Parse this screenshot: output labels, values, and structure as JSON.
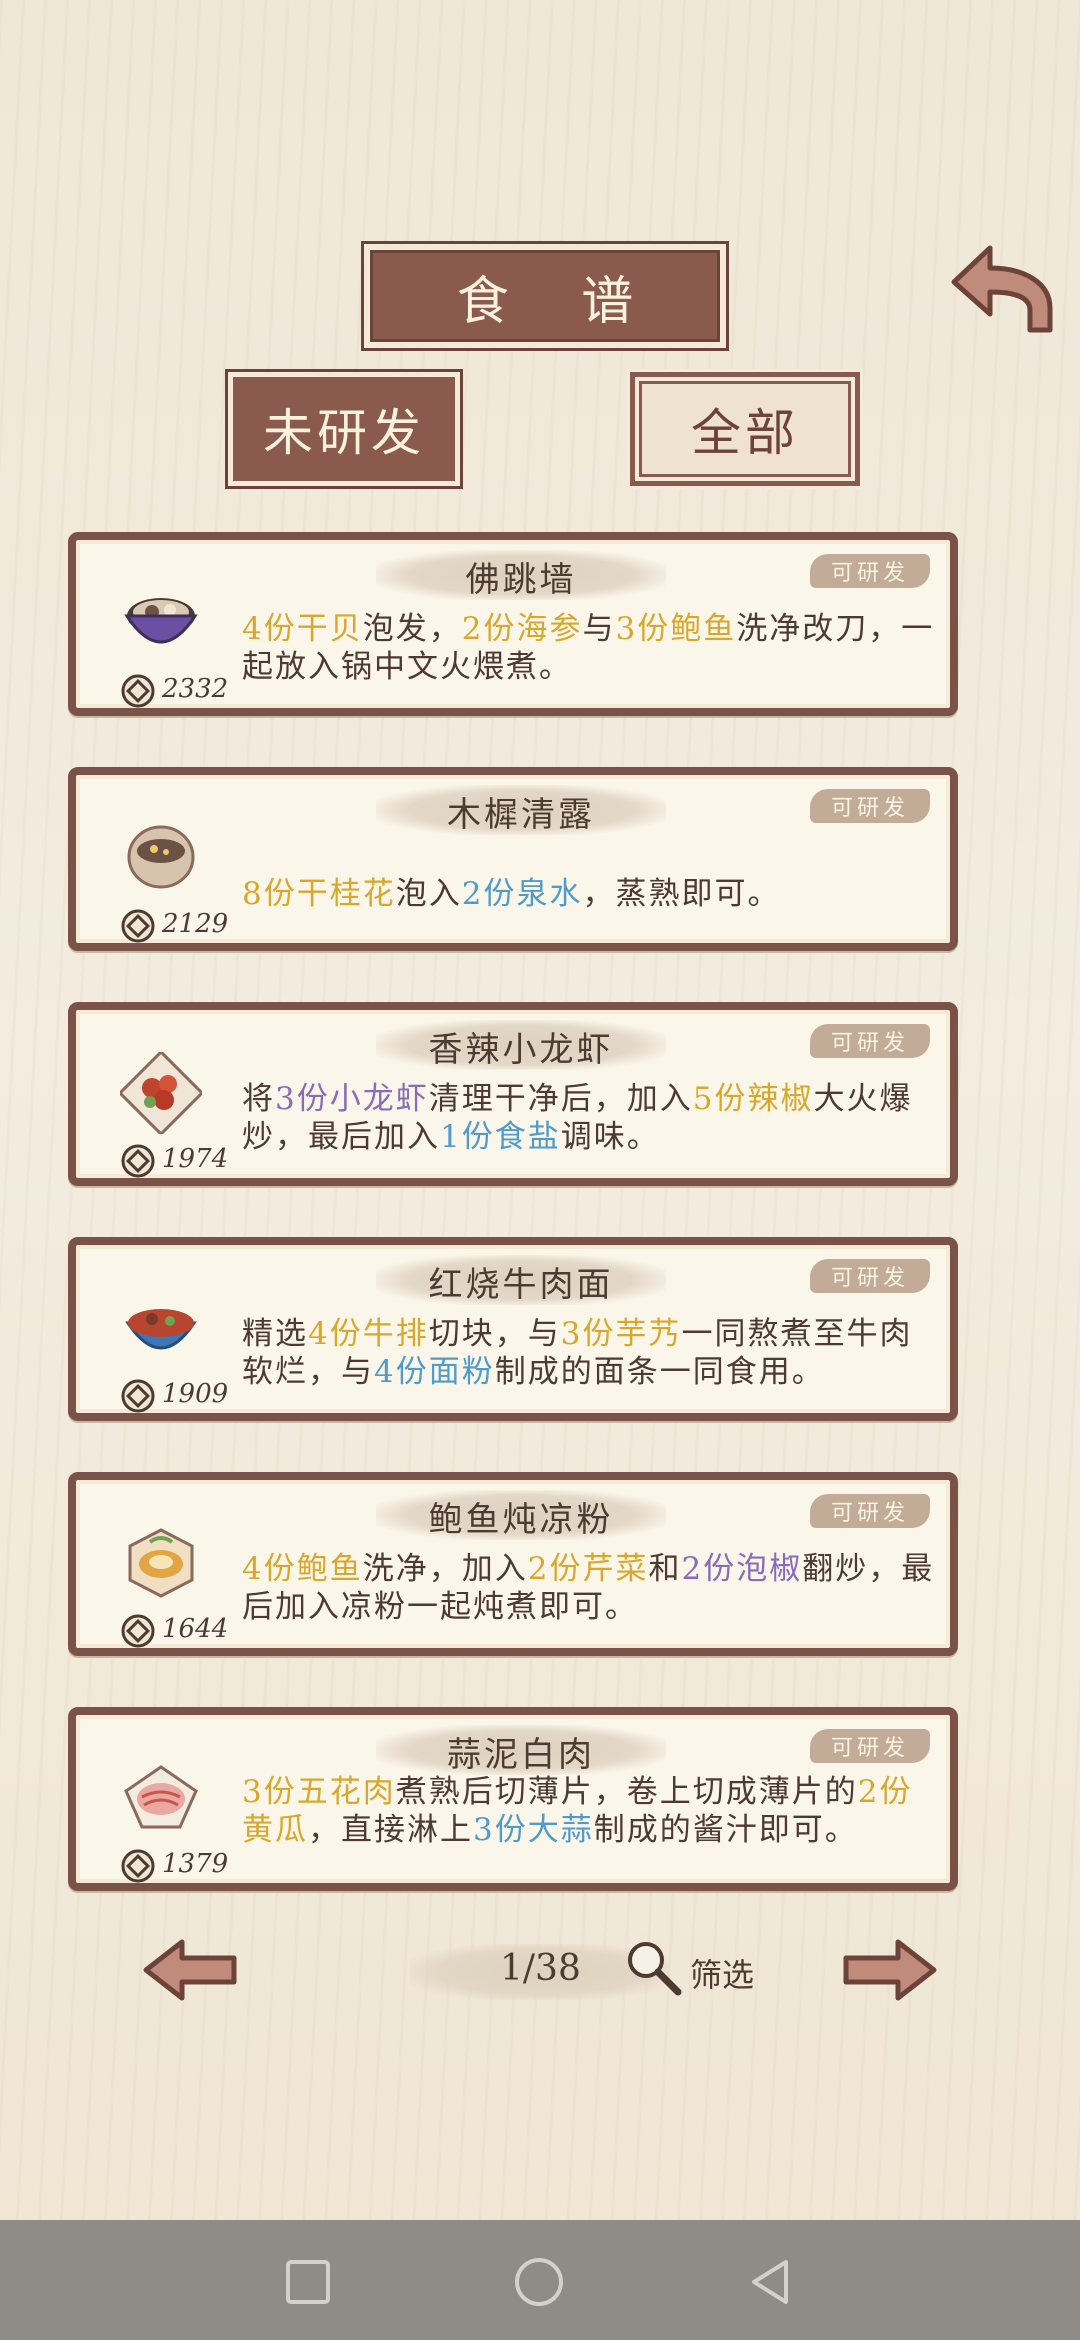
{
  "header": {
    "title": "食 谱"
  },
  "tabs": [
    {
      "label": "未研发"
    },
    {
      "label": "全部"
    }
  ],
  "recipes": [
    {
      "name": "佛跳墙",
      "badge": "可研发",
      "price": "2332",
      "desc": [
        {
          "t": "4份干贝",
          "c": "y"
        },
        {
          "t": "泡发，",
          "c": ""
        },
        {
          "t": "2份海参",
          "c": "y"
        },
        {
          "t": "与",
          "c": ""
        },
        {
          "t": "3份鲍鱼",
          "c": "y"
        },
        {
          "t": "洗净改刀，一起放入锅中文火煨煮。",
          "c": ""
        }
      ]
    },
    {
      "name": "木樨清露",
      "badge": "可研发",
      "price": "2129",
      "desc": [
        {
          "t": "8份干桂花",
          "c": "y"
        },
        {
          "t": "泡入",
          "c": ""
        },
        {
          "t": "2份泉水",
          "c": "b"
        },
        {
          "t": "，蒸熟即可。",
          "c": ""
        }
      ]
    },
    {
      "name": "香辣小龙虾",
      "badge": "可研发",
      "price": "1974",
      "desc": [
        {
          "t": "将",
          "c": ""
        },
        {
          "t": "3份小龙虾",
          "c": "p"
        },
        {
          "t": "清理干净后，加入",
          "c": ""
        },
        {
          "t": "5份辣椒",
          "c": "y"
        },
        {
          "t": "大火爆炒，最后加入",
          "c": ""
        },
        {
          "t": "1份食盐",
          "c": "b"
        },
        {
          "t": "调味。",
          "c": ""
        }
      ]
    },
    {
      "name": "红烧牛肉面",
      "badge": "可研发",
      "price": "1909",
      "desc": [
        {
          "t": "精选",
          "c": ""
        },
        {
          "t": "4份牛排",
          "c": "y"
        },
        {
          "t": "切块，与",
          "c": ""
        },
        {
          "t": "3份芋艿",
          "c": "y"
        },
        {
          "t": "一同熬煮至牛肉软烂，与",
          "c": ""
        },
        {
          "t": "4份面粉",
          "c": "b"
        },
        {
          "t": "制成的面条一同食用。",
          "c": ""
        }
      ]
    },
    {
      "name": "鲍鱼炖凉粉",
      "badge": "可研发",
      "price": "1644",
      "desc": [
        {
          "t": "4份鲍鱼",
          "c": "y"
        },
        {
          "t": "洗净，加入",
          "c": ""
        },
        {
          "t": "2份芹菜",
          "c": "y"
        },
        {
          "t": "和",
          "c": ""
        },
        {
          "t": "2份泡椒",
          "c": "p"
        },
        {
          "t": "翻炒，最后加入凉粉一起炖煮即可。",
          "c": ""
        }
      ]
    },
    {
      "name": "蒜泥白肉",
      "badge": "可研发",
      "price": "1379",
      "desc": [
        {
          "t": "3份五花肉",
          "c": "y"
        },
        {
          "t": "煮熟后切薄片，卷上切成薄片的",
          "c": ""
        },
        {
          "t": "2份黄瓜",
          "c": "y"
        },
        {
          "t": "，直接淋上",
          "c": ""
        },
        {
          "t": "3份大蒜",
          "c": "b"
        },
        {
          "t": "制成的酱汁即可。",
          "c": ""
        }
      ]
    }
  ],
  "footer": {
    "page": "1/38",
    "filter_label": "筛选"
  },
  "icons": {
    "back": "curved-back-arrow-icon",
    "prev": "left-arrow-icon",
    "next": "right-arrow-icon",
    "search": "magnifier-icon",
    "coin": "coin-icon"
  },
  "colors": {
    "ingredient_yellow": "#d8a82c",
    "ingredient_purple": "#8a6bb8",
    "ingredient_blue": "#4f9bcb",
    "frame": "#7b5247"
  }
}
